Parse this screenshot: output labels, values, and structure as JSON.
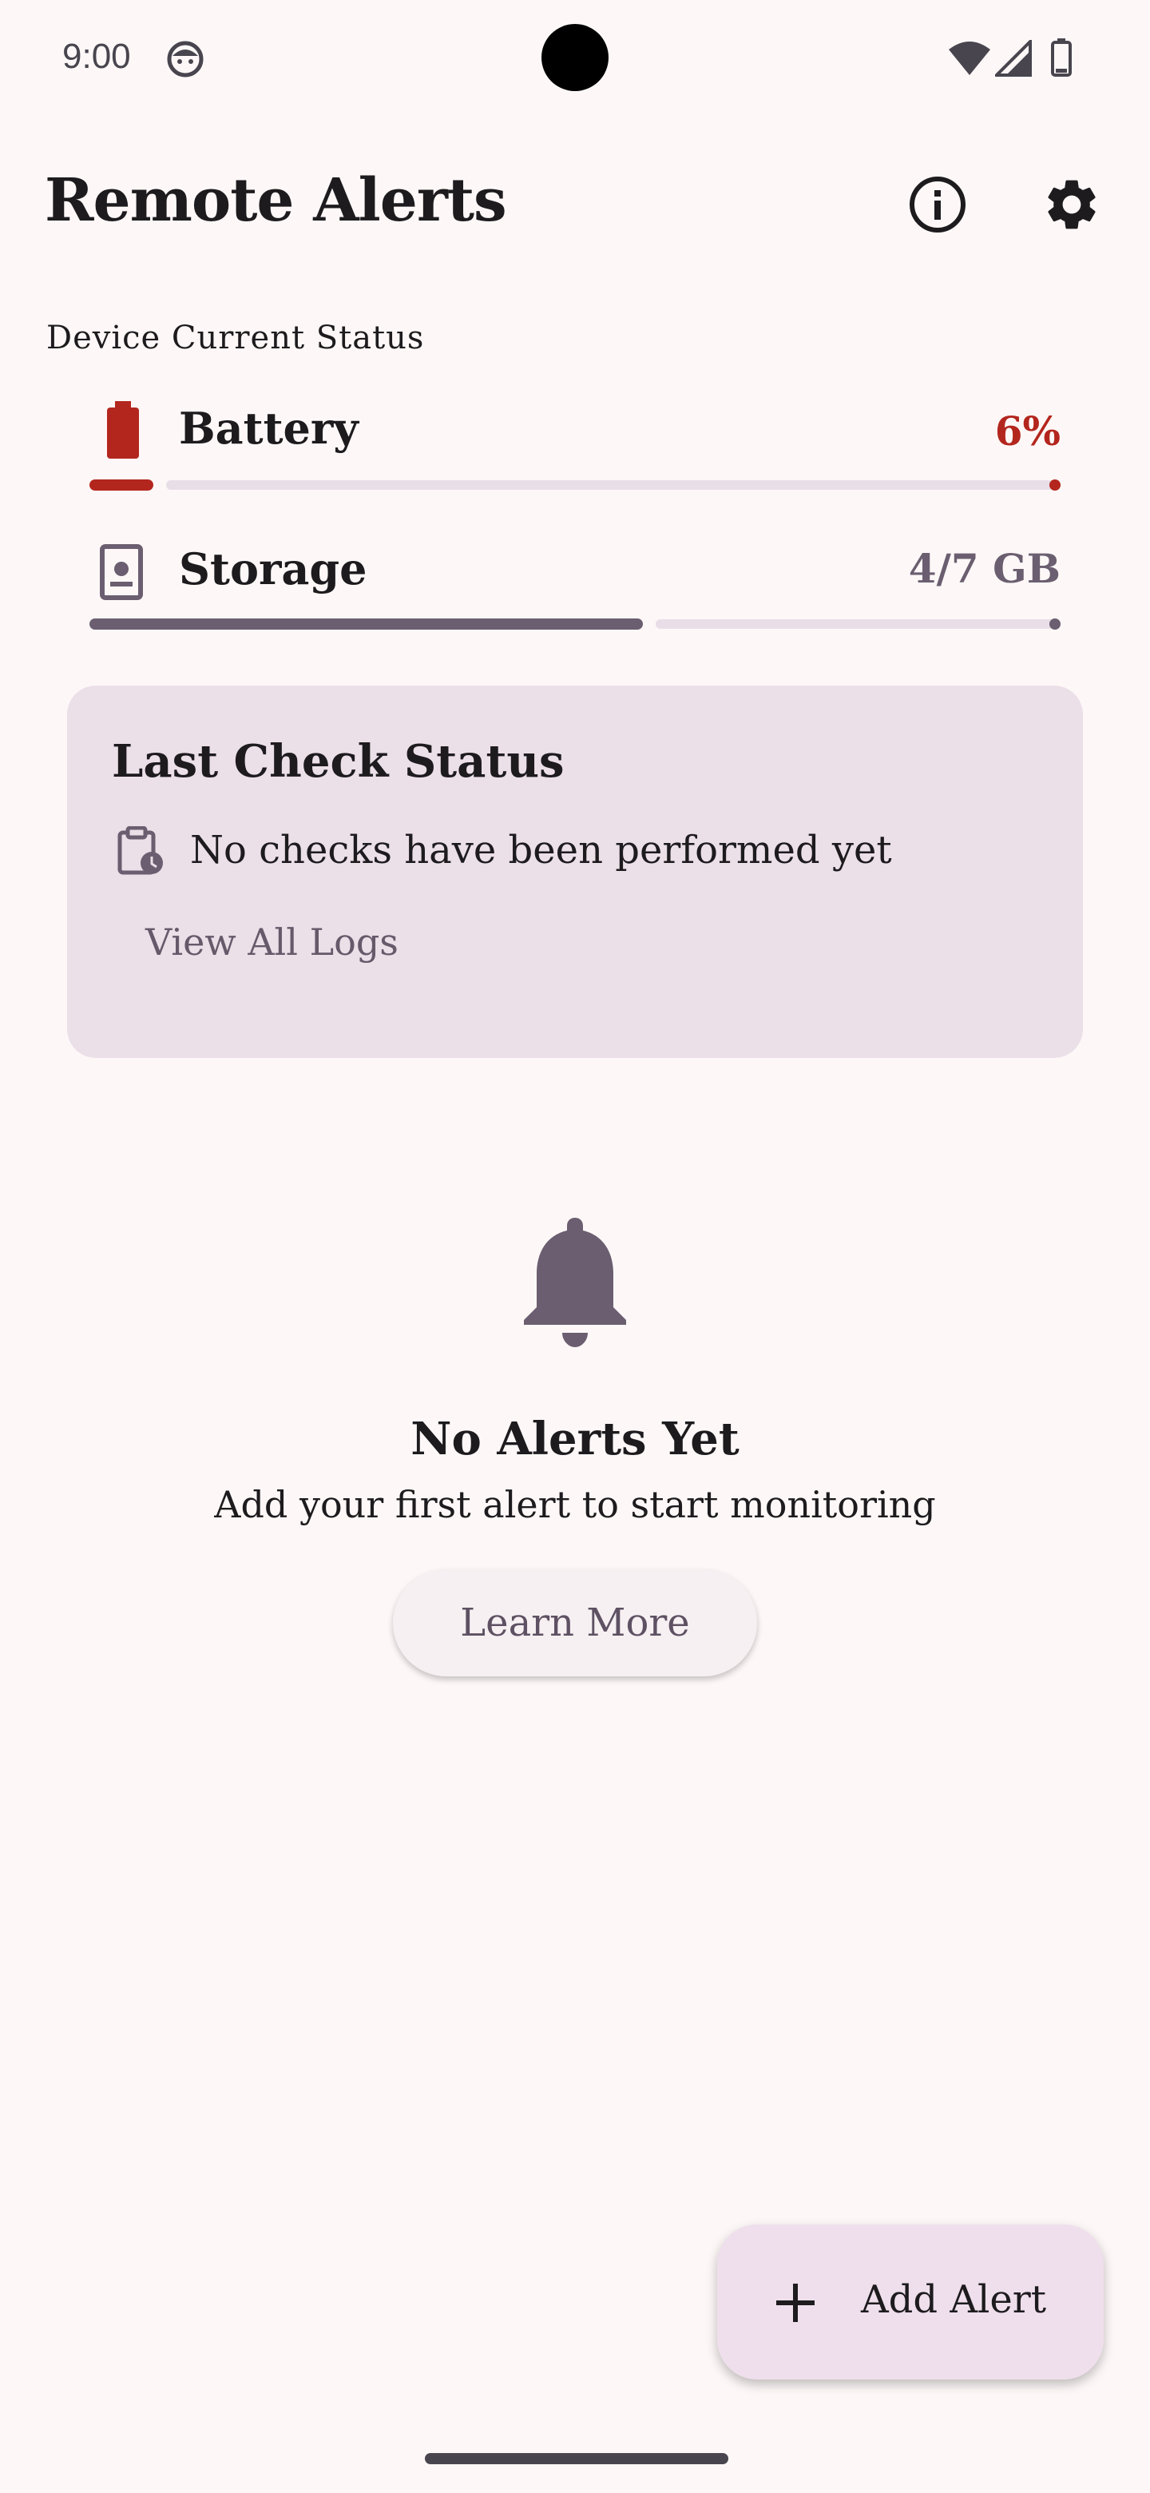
{
  "status_bar": {
    "time": "9:00"
  },
  "header": {
    "title": "Remote Alerts",
    "info_icon": "info-icon",
    "settings_icon": "gear-icon"
  },
  "device": {
    "section_label": "Device Current Status",
    "battery": {
      "label": "Battery",
      "value": "6%",
      "level": 0.06,
      "color": "#b3261e",
      "icon": "battery-icon"
    },
    "storage": {
      "label": "Storage",
      "value": "4/7 GB",
      "level": 0.57,
      "color": "#6b5e70",
      "icon": "storage-icon"
    }
  },
  "last_check": {
    "title": "Last Check Status",
    "message": "No checks have been performed yet",
    "link_label": "View All Logs",
    "icon": "clipboard-clock-icon"
  },
  "empty_state": {
    "icon": "bell-icon",
    "title": "No Alerts Yet",
    "subtitle": "Add your first alert to start monitoring",
    "button_label": "Learn More"
  },
  "fab": {
    "label": "Add Alert",
    "icon": "plus-icon"
  },
  "colors": {
    "background": "#fdf8f7",
    "card": "#ebdfe8",
    "accent_red": "#b3261e",
    "muted_purple": "#6b5e70",
    "track": "#e8dee8"
  }
}
